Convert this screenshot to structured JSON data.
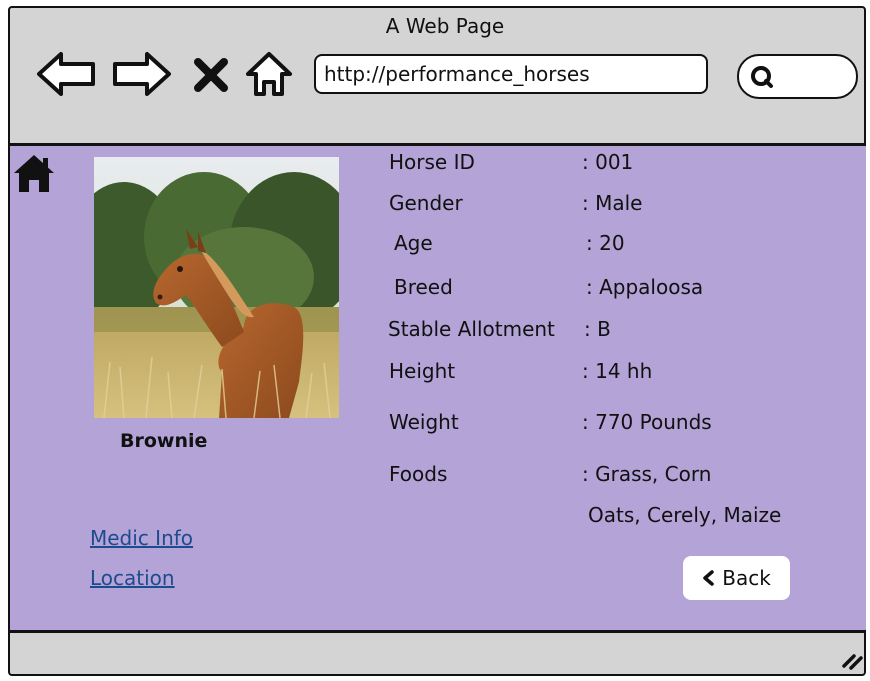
{
  "window": {
    "title": "A Web Page"
  },
  "toolbar": {
    "url": "http://performance_horses"
  },
  "horse": {
    "name": "Brownie",
    "fields": [
      {
        "label": "Horse ID",
        "value": ": 001"
      },
      {
        "label": "Gender",
        "value": ":  Male"
      },
      {
        "label": "Age",
        "value": ":  20"
      },
      {
        "label": "Breed",
        "value": ":  Appaloosa"
      },
      {
        "label": "Stable Allotment",
        "value": ": B"
      },
      {
        "label": "Height",
        "value": ":  14 hh"
      },
      {
        "label": "Weight",
        "value": ":  770 Pounds"
      },
      {
        "label": "Foods",
        "value": ": Grass, Corn"
      }
    ],
    "foods_line2": "Oats, Cerely, Maize"
  },
  "links": {
    "medic": "Medic Info",
    "location": "Location"
  },
  "back_label": "Back"
}
